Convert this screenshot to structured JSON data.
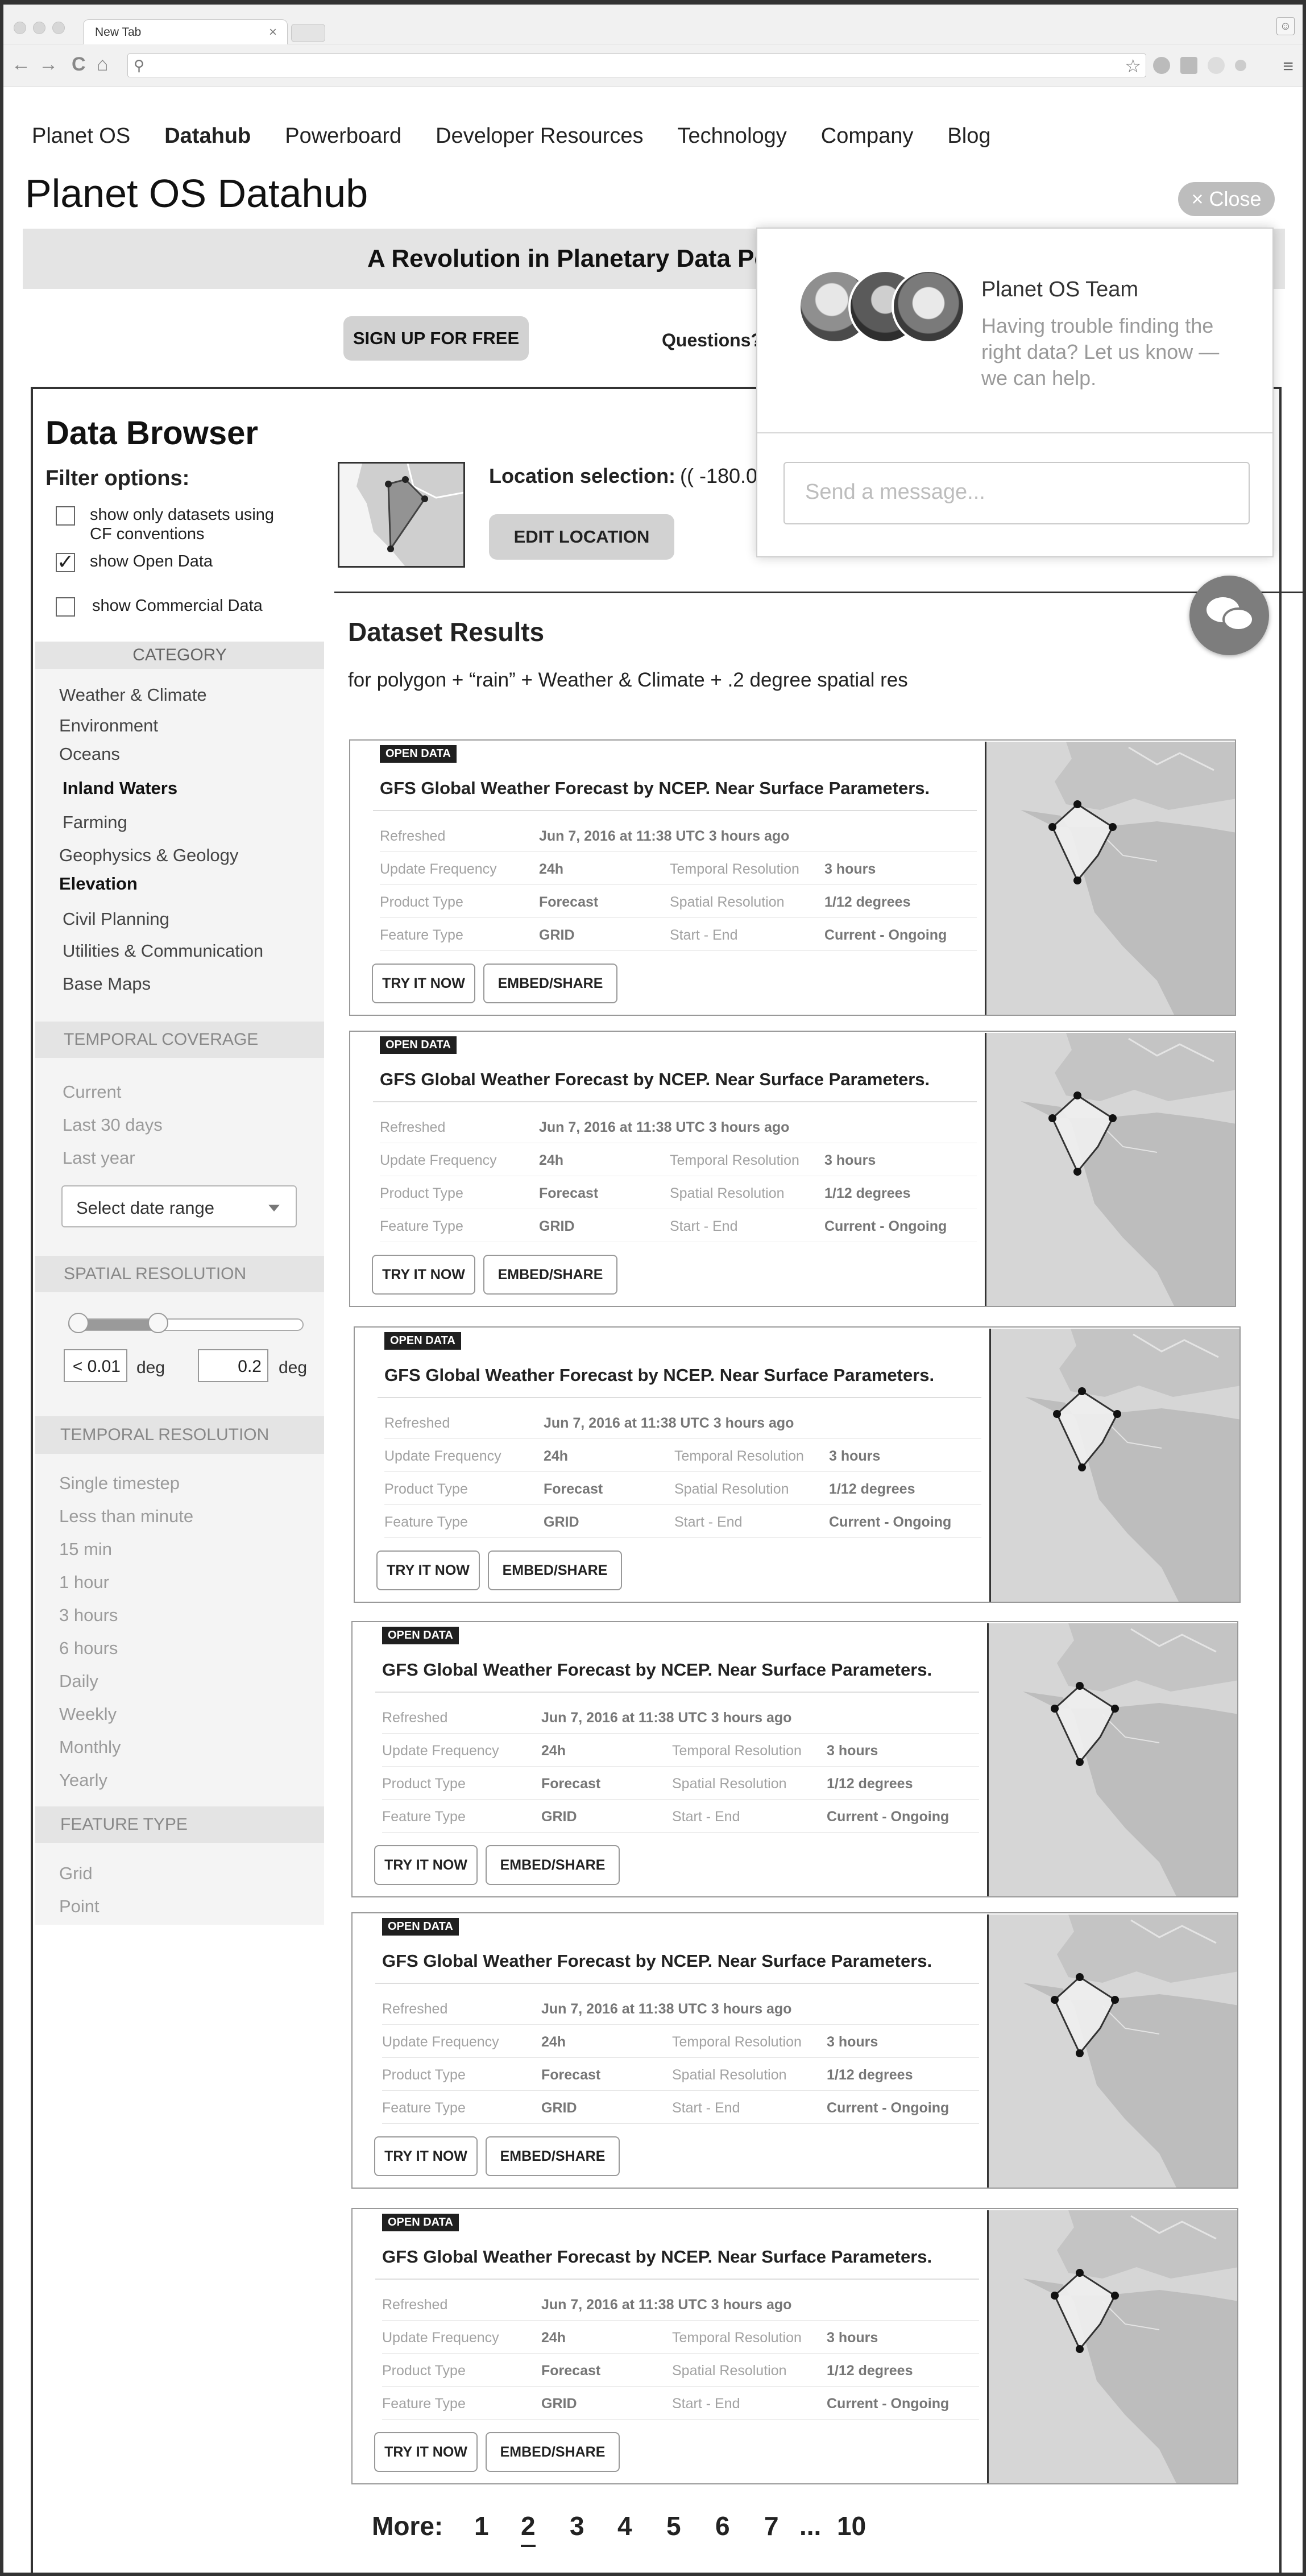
{
  "browser": {
    "tab_title": "New Tab",
    "tab_close": "×",
    "profile_icon": "person-icon",
    "nav": {
      "back": "←",
      "forward": "→",
      "reload": "C",
      "home": "⌂",
      "search_glyph": "🔍",
      "star": "☆",
      "menu": "≡"
    }
  },
  "site_nav": {
    "items": [
      "Planet OS",
      "Datahub",
      "Powerboard",
      "Developer Resources",
      "Technology",
      "Company",
      "Blog"
    ],
    "active": "Datahub"
  },
  "page_title": "Planet OS Datahub",
  "banner": {
    "text": "A Revolution in Planetary Data Po"
  },
  "signup_label": "SIGN UP FOR FREE",
  "questions_label": "Questions?",
  "chat": {
    "close_label": "× Close",
    "team_name": "Planet OS Team",
    "message": "Having trouble finding the right data? Let us know — we can help.",
    "input_placeholder": "Send a message..."
  },
  "data_browser": {
    "title": "Data Browser",
    "filter_title": "Filter options:",
    "checks": [
      {
        "label": "show only datasets using CF conventions",
        "checked": false
      },
      {
        "label": "show Open Data",
        "checked": true
      },
      {
        "label": "show Commercial Data",
        "checked": false
      }
    ],
    "category_head": "CATEGORY",
    "categories": [
      {
        "label": "Weather & Climate",
        "bold": false
      },
      {
        "label": "Environment",
        "bold": false
      },
      {
        "label": "Oceans",
        "bold": false
      },
      {
        "label": "Inland Waters",
        "bold": true
      },
      {
        "label": "Farming",
        "bold": false
      },
      {
        "label": "Geophysics & Geology",
        "bold": false
      },
      {
        "label": "Elevation",
        "bold": true
      },
      {
        "label": "Civil Planning",
        "bold": false
      },
      {
        "label": "Utilities & Communication",
        "bold": false
      },
      {
        "label": "Base Maps",
        "bold": false
      }
    ],
    "temporal_coverage_head": "TEMPORAL COVERAGE",
    "temporal_coverage": [
      "Current",
      "Last 30 days",
      "Last year"
    ],
    "date_range_label": "Select date range",
    "spatial_head": "SPATIAL RESOLUTION",
    "spatial_min": "< 0.01",
    "spatial_max": "0.2",
    "spatial_unit": "deg",
    "spatial_range_fraction": [
      0.0,
      0.37
    ],
    "temporal_res_head": "TEMPORAL RESOLUTION",
    "temporal_res": [
      "Single timestep",
      "Less than minute",
      "15 min",
      "1 hour",
      "3 hours",
      "6 hours",
      "Daily",
      "Weekly",
      "Monthly",
      "Yearly"
    ],
    "feature_head": "FEATURE TYPE",
    "features": [
      "Grid",
      "Point"
    ]
  },
  "location": {
    "label": "Location selection:",
    "value": "(( -180.0(",
    "edit_label": "EDIT LOCATION"
  },
  "results": {
    "title": "Dataset Results",
    "subtitle": "for polygon + “rain” + Weather & Climate + .2 degree spatial res",
    "cards": [
      {
        "badge": "OPEN DATA",
        "title": "GFS Global Weather Forecast by NCEP. Near Surface Parameters.",
        "refreshed_k": "Refreshed",
        "refreshed_v": "Jun 7, 2016 at 11:38 UTC 3 hours ago",
        "freq_k": "Update Frequency",
        "freq_v": "24h",
        "tres_k": "Temporal Resolution",
        "tres_v": "3 hours",
        "ptype_k": "Product Type",
        "ptype_v": "Forecast",
        "sres_k": "Spatial Resolution",
        "sres_v": "1/12 degrees",
        "ftype_k": "Feature Type",
        "ftype_v": "GRID",
        "se_k": "Start - End",
        "se_v": "Current - Ongoing",
        "try_label": "TRY IT NOW",
        "embed_label": "EMBED/SHARE"
      },
      {
        "badge": "OPEN DATA",
        "title": "GFS Global Weather Forecast by NCEP. Near Surface Parameters.",
        "refreshed_k": "Refreshed",
        "refreshed_v": "Jun 7, 2016 at 11:38 UTC 3 hours ago",
        "freq_k": "Update Frequency",
        "freq_v": "24h",
        "tres_k": "Temporal Resolution",
        "tres_v": "3 hours",
        "ptype_k": "Product Type",
        "ptype_v": "Forecast",
        "sres_k": "Spatial Resolution",
        "sres_v": "1/12 degrees",
        "ftype_k": "Feature Type",
        "ftype_v": "GRID",
        "se_k": "Start - End",
        "se_v": "Current - Ongoing",
        "try_label": "TRY IT NOW",
        "embed_label": "EMBED/SHARE"
      },
      {
        "badge": "OPEN DATA",
        "title": "GFS Global Weather Forecast by NCEP. Near Surface Parameters.",
        "refreshed_k": "Refreshed",
        "refreshed_v": "Jun 7, 2016 at 11:38 UTC 3 hours ago",
        "freq_k": "Update Frequency",
        "freq_v": "24h",
        "tres_k": "Temporal Resolution",
        "tres_v": "3 hours",
        "ptype_k": "Product Type",
        "ptype_v": "Forecast",
        "sres_k": "Spatial Resolution",
        "sres_v": "1/12 degrees",
        "ftype_k": "Feature Type",
        "ftype_v": "GRID",
        "se_k": "Start - End",
        "se_v": "Current - Ongoing",
        "try_label": "TRY IT NOW",
        "embed_label": "EMBED/SHARE"
      },
      {
        "badge": "OPEN DATA",
        "title": "GFS Global Weather Forecast by NCEP. Near Surface Parameters.",
        "refreshed_k": "Refreshed",
        "refreshed_v": "Jun 7, 2016 at 11:38 UTC 3 hours ago",
        "freq_k": "Update Frequency",
        "freq_v": "24h",
        "tres_k": "Temporal Resolution",
        "tres_v": "3 hours",
        "ptype_k": "Product Type",
        "ptype_v": "Forecast",
        "sres_k": "Spatial Resolution",
        "sres_v": "1/12 degrees",
        "ftype_k": "Feature Type",
        "ftype_v": "GRID",
        "se_k": "Start - End",
        "se_v": "Current - Ongoing",
        "try_label": "TRY IT NOW",
        "embed_label": "EMBED/SHARE"
      },
      {
        "badge": "OPEN DATA",
        "title": "GFS Global Weather Forecast by NCEP. Near Surface Parameters.",
        "refreshed_k": "Refreshed",
        "refreshed_v": "Jun 7, 2016 at 11:38 UTC 3 hours ago",
        "freq_k": "Update Frequency",
        "freq_v": "24h",
        "tres_k": "Temporal Resolution",
        "tres_v": "3 hours",
        "ptype_k": "Product Type",
        "ptype_v": "Forecast",
        "sres_k": "Spatial Resolution",
        "sres_v": "1/12 degrees",
        "ftype_k": "Feature Type",
        "ftype_v": "GRID",
        "se_k": "Start - End",
        "se_v": "Current - Ongoing",
        "try_label": "TRY IT NOW",
        "embed_label": "EMBED/SHARE"
      },
      {
        "badge": "OPEN DATA",
        "title": "GFS Global Weather Forecast by NCEP. Near Surface Parameters.",
        "refreshed_k": "Refreshed",
        "refreshed_v": "Jun 7, 2016 at 11:38 UTC 3 hours ago",
        "freq_k": "Update Frequency",
        "freq_v": "24h",
        "tres_k": "Temporal Resolution",
        "tres_v": "3 hours",
        "ptype_k": "Product Type",
        "ptype_v": "Forecast",
        "sres_k": "Spatial Resolution",
        "sres_v": "1/12 degrees",
        "ftype_k": "Feature Type",
        "ftype_v": "GRID",
        "se_k": "Start - End",
        "se_v": "Current - Ongoing",
        "try_label": "TRY IT NOW",
        "embed_label": "EMBED/SHARE"
      }
    ]
  },
  "pager": {
    "label": "More:",
    "pages": [
      "1",
      "2",
      "3",
      "4",
      "5",
      "6",
      "7",
      "...",
      "10"
    ],
    "current": "2"
  }
}
